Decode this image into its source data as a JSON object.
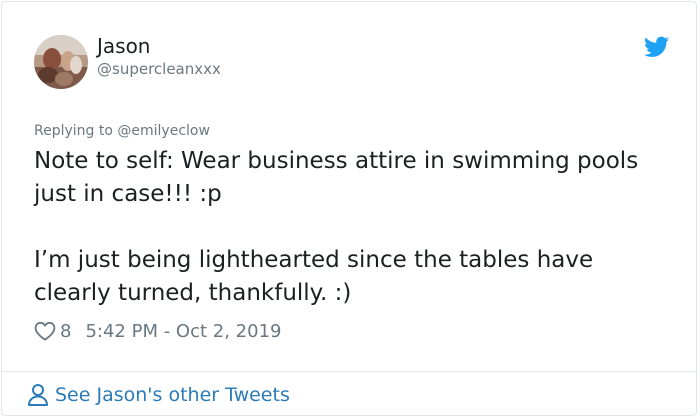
{
  "author": {
    "name": "Jason",
    "handle": "@supercleanxxx",
    "avatar": "avatar-photo"
  },
  "brand": {
    "icon": "twitter-bird-icon",
    "color": "#1da1f2"
  },
  "reply": {
    "prefix": "Replying to ",
    "to": "@emilyeclow"
  },
  "tweet": {
    "paragraphs": [
      "Note to self: Wear business attire in swimming pools just in case!!! :p",
      "I’m just being lighthearted since the tables have clearly turned, thankfully. :)"
    ]
  },
  "meta": {
    "likes_icon": "heart-icon",
    "likes": "8",
    "timestamp": "5:42 PM - Oct 2, 2019"
  },
  "footer": {
    "icon": "person-icon",
    "label": "See Jason's other Tweets",
    "color": "#2b7bb9"
  }
}
